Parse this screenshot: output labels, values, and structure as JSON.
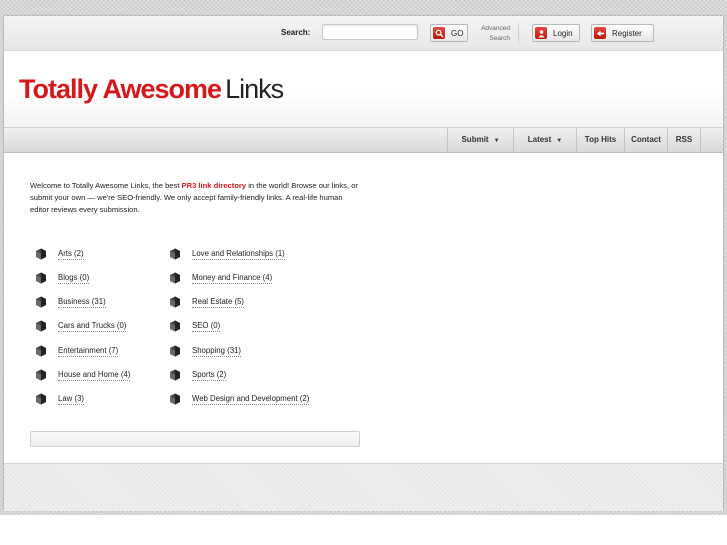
{
  "topbar": {
    "search_label": "Search:",
    "search_value": "",
    "go_label": "GO",
    "advanced_search_line1": "Advanced",
    "advanced_search_line2": "Search",
    "login_label": "Login",
    "register_label": "Register"
  },
  "header": {
    "logo_part1": "Totally Awesome",
    "logo_part2": "Links"
  },
  "nav": {
    "items": [
      {
        "label": "Submit",
        "has_arrow": true
      },
      {
        "label": "Latest",
        "has_arrow": true
      },
      {
        "label": "Top Hits",
        "has_arrow": false
      },
      {
        "label": "Contact",
        "has_arrow": false
      },
      {
        "label": "RSS",
        "has_arrow": false
      }
    ],
    "arrow": "▼"
  },
  "intro": {
    "before": "Welcome to Totally Awesome Links, the best ",
    "highlight": "PR3 link directory",
    "after": " in the world! Browse our links, or submit your own — we're SEO-friendly. We only accept family-friendly links. A real-life human editor reviews every submission."
  },
  "categories": {
    "left": [
      "Arts (2)",
      "Blogs (0)",
      "Business (31)",
      "Cars and Trucks (0)",
      "Entertainment (7)",
      "House and Home (4)",
      "Law (3)"
    ],
    "right": [
      "Love and Relationships (1)",
      "Money and Finance (4)",
      "Real Estate (5)",
      "SEO (0)",
      "Shopping (31)",
      "Sports (2)",
      "Web Design and Development (2)"
    ]
  },
  "colors": {
    "accent": "#d8171d",
    "text": "#222222"
  }
}
